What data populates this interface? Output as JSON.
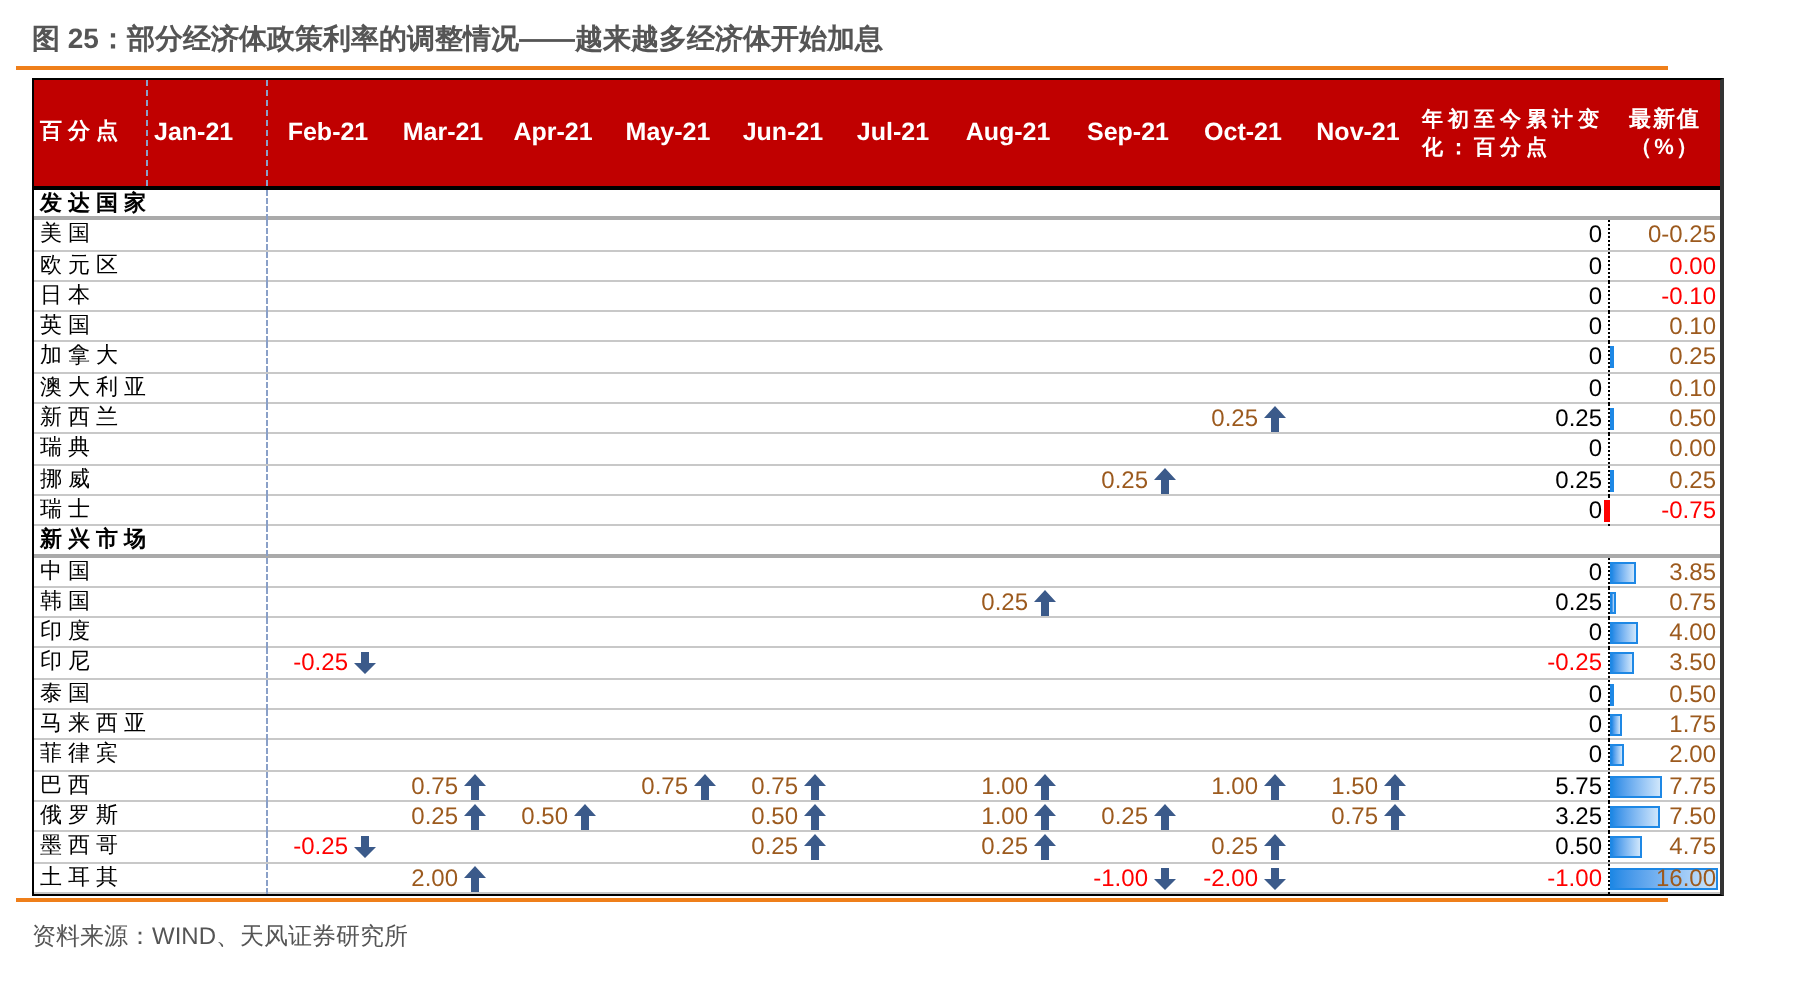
{
  "title": "图 25：部分经济体政策利率的调整情况——越来越多经济体开始加息",
  "header": {
    "corner": "百分点",
    "months": [
      "Jan-21",
      "Feb-21",
      "Mar-21",
      "Apr-21",
      "May-21",
      "Jun-21",
      "Jul-21",
      "Aug-21",
      "Sep-21",
      "Oct-21",
      "Nov-21"
    ],
    "ytd": "年初至今累计变化：百分点",
    "latest": "最新值（%）"
  },
  "sections": [
    {
      "name": "发达国家",
      "rows": [
        {
          "name": "美国",
          "changes": [
            {
              "kind": "none"
            },
            {
              "kind": "none"
            },
            {
              "kind": "none"
            },
            {
              "kind": "none"
            },
            {
              "kind": "none"
            },
            {
              "kind": "none"
            },
            {
              "kind": "none"
            },
            {
              "kind": "none"
            },
            {
              "kind": "none"
            },
            {
              "kind": "none"
            }
          ],
          "ytd": {
            "text": "0",
            "color": "#000000"
          },
          "latest": {
            "text": "0-0.25",
            "color": "#9c5a1e"
          }
        },
        {
          "name": "欧元区",
          "changes": [
            {
              "kind": "none"
            },
            {
              "kind": "none"
            },
            {
              "kind": "none"
            },
            {
              "kind": "none"
            },
            {
              "kind": "none"
            },
            {
              "kind": "none"
            },
            {
              "kind": "none"
            },
            {
              "kind": "none"
            },
            {
              "kind": "none"
            },
            {
              "kind": "none"
            }
          ],
          "ytd": {
            "text": "0",
            "color": "#000000"
          },
          "latest": {
            "text": "0.00",
            "color": "#ff0000"
          }
        },
        {
          "name": "日本",
          "changes": [
            {
              "kind": "none"
            },
            {
              "kind": "none"
            },
            {
              "kind": "none"
            },
            {
              "kind": "none"
            },
            {
              "kind": "none"
            },
            {
              "kind": "none"
            },
            {
              "kind": "none"
            },
            {
              "kind": "none"
            },
            {
              "kind": "none"
            },
            {
              "kind": "none"
            }
          ],
          "ytd": {
            "text": "0",
            "color": "#000000"
          },
          "latest": {
            "text": "-0.10",
            "color": "#ff0000"
          }
        },
        {
          "name": "英国",
          "changes": [
            {
              "kind": "none"
            },
            {
              "kind": "none"
            },
            {
              "kind": "none"
            },
            {
              "kind": "none"
            },
            {
              "kind": "none"
            },
            {
              "kind": "none"
            },
            {
              "kind": "none"
            },
            {
              "kind": "none"
            },
            {
              "kind": "none"
            },
            {
              "kind": "none"
            }
          ],
          "ytd": {
            "text": "0",
            "color": "#000000"
          },
          "latest": {
            "text": "0.10",
            "color": "#9c5a1e"
          }
        },
        {
          "name": "加拿大",
          "changes": [
            {
              "kind": "none"
            },
            {
              "kind": "none"
            },
            {
              "kind": "none"
            },
            {
              "kind": "none"
            },
            {
              "kind": "none"
            },
            {
              "kind": "none"
            },
            {
              "kind": "none"
            },
            {
              "kind": "none"
            },
            {
              "kind": "none"
            },
            {
              "kind": "none"
            }
          ],
          "ytd": {
            "text": "0",
            "color": "#000000"
          },
          "latest": {
            "text": "0.25",
            "color": "#9c5a1e"
          },
          "bar": {
            "kind": "positive",
            "level": 0.03
          }
        },
        {
          "name": "澳大利亚",
          "changes": [
            {
              "kind": "none"
            },
            {
              "kind": "none"
            },
            {
              "kind": "none"
            },
            {
              "kind": "none"
            },
            {
              "kind": "none"
            },
            {
              "kind": "none"
            },
            {
              "kind": "none"
            },
            {
              "kind": "none"
            },
            {
              "kind": "none"
            },
            {
              "kind": "none"
            }
          ],
          "ytd": {
            "text": "0",
            "color": "#000000"
          },
          "latest": {
            "text": "0.10",
            "color": "#9c5a1e"
          }
        },
        {
          "name": "新西兰",
          "changes": [
            {
              "kind": "none"
            },
            {
              "kind": "none"
            },
            {
              "kind": "none"
            },
            {
              "kind": "none"
            },
            {
              "kind": "none"
            },
            {
              "kind": "none"
            },
            {
              "kind": "none"
            },
            {
              "kind": "none"
            },
            {
              "text": "0.25",
              "kind": "up"
            },
            {
              "kind": "none"
            }
          ],
          "ytd": {
            "text": "0.25",
            "color": "#000000"
          },
          "latest": {
            "text": "0.50",
            "color": "#9c5a1e"
          },
          "bar": {
            "kind": "positive",
            "level": 0.04
          }
        },
        {
          "name": "瑞典",
          "changes": [
            {
              "kind": "none"
            },
            {
              "kind": "none"
            },
            {
              "kind": "none"
            },
            {
              "kind": "none"
            },
            {
              "kind": "none"
            },
            {
              "kind": "none"
            },
            {
              "kind": "none"
            },
            {
              "kind": "none"
            },
            {
              "kind": "none"
            },
            {
              "kind": "none"
            }
          ],
          "ytd": {
            "text": "0",
            "color": "#000000"
          },
          "latest": {
            "text": "0.00",
            "color": "#9c5a1e"
          }
        },
        {
          "name": "挪威",
          "changes": [
            {
              "kind": "none"
            },
            {
              "kind": "none"
            },
            {
              "kind": "none"
            },
            {
              "kind": "none"
            },
            {
              "kind": "none"
            },
            {
              "kind": "none"
            },
            {
              "kind": "none"
            },
            {
              "text": "0.25",
              "kind": "up"
            },
            {
              "kind": "none"
            },
            {
              "kind": "none"
            }
          ],
          "ytd": {
            "text": "0.25",
            "color": "#000000"
          },
          "latest": {
            "text": "0.25",
            "color": "#9c5a1e"
          },
          "bar": {
            "kind": "positive",
            "level": 0.03
          }
        },
        {
          "name": "瑞士",
          "changes": [
            {
              "kind": "none"
            },
            {
              "kind": "none"
            },
            {
              "kind": "none"
            },
            {
              "kind": "none"
            },
            {
              "kind": "none"
            },
            {
              "kind": "none"
            },
            {
              "kind": "none"
            },
            {
              "kind": "none"
            },
            {
              "kind": "none"
            },
            {
              "kind": "none"
            }
          ],
          "ytd": {
            "text": "0",
            "color": "#000000"
          },
          "latest": {
            "text": "-0.75",
            "color": "#ff0000"
          },
          "bar": {
            "kind": "negative",
            "level": 0.05
          }
        }
      ]
    },
    {
      "name": "新兴市场",
      "rows": [
        {
          "name": "中国",
          "changes": [
            {
              "kind": "none"
            },
            {
              "kind": "none"
            },
            {
              "kind": "none"
            },
            {
              "kind": "none"
            },
            {
              "kind": "none"
            },
            {
              "kind": "none"
            },
            {
              "kind": "none"
            },
            {
              "kind": "none"
            },
            {
              "kind": "none"
            },
            {
              "kind": "none"
            }
          ],
          "ytd": {
            "text": "0",
            "color": "#000000"
          },
          "latest": {
            "text": "3.85",
            "color": "#9c5a1e"
          },
          "bar": {
            "kind": "positive",
            "level": 0.24
          }
        },
        {
          "name": "韩国",
          "changes": [
            {
              "kind": "none"
            },
            {
              "kind": "none"
            },
            {
              "kind": "none"
            },
            {
              "kind": "none"
            },
            {
              "kind": "none"
            },
            {
              "kind": "none"
            },
            {
              "text": "0.25",
              "kind": "up"
            },
            {
              "kind": "none"
            },
            {
              "kind": "none"
            },
            {
              "kind": "none"
            }
          ],
          "ytd": {
            "text": "0.25",
            "color": "#000000"
          },
          "latest": {
            "text": "0.75",
            "color": "#9c5a1e"
          },
          "bar": {
            "kind": "positive",
            "level": 0.05
          }
        },
        {
          "name": "印度",
          "changes": [
            {
              "kind": "none"
            },
            {
              "kind": "none"
            },
            {
              "kind": "none"
            },
            {
              "kind": "none"
            },
            {
              "kind": "none"
            },
            {
              "kind": "none"
            },
            {
              "kind": "none"
            },
            {
              "kind": "none"
            },
            {
              "kind": "none"
            },
            {
              "kind": "none"
            }
          ],
          "ytd": {
            "text": "0",
            "color": "#000000"
          },
          "latest": {
            "text": "4.00",
            "color": "#9c5a1e"
          },
          "bar": {
            "kind": "positive",
            "level": 0.25
          }
        },
        {
          "name": "印尼",
          "changes": [
            {
              "text": "-0.25",
              "kind": "down"
            },
            {
              "kind": "none"
            },
            {
              "kind": "none"
            },
            {
              "kind": "none"
            },
            {
              "kind": "none"
            },
            {
              "kind": "none"
            },
            {
              "kind": "none"
            },
            {
              "kind": "none"
            },
            {
              "kind": "none"
            },
            {
              "kind": "none"
            }
          ],
          "ytd": {
            "text": "-0.25",
            "color": "#ff0000"
          },
          "latest": {
            "text": "3.50",
            "color": "#9c5a1e"
          },
          "bar": {
            "kind": "positive",
            "level": 0.22
          }
        },
        {
          "name": "泰国",
          "changes": [
            {
              "kind": "none"
            },
            {
              "kind": "none"
            },
            {
              "kind": "none"
            },
            {
              "kind": "none"
            },
            {
              "kind": "none"
            },
            {
              "kind": "none"
            },
            {
              "kind": "none"
            },
            {
              "kind": "none"
            },
            {
              "kind": "none"
            },
            {
              "kind": "none"
            }
          ],
          "ytd": {
            "text": "0",
            "color": "#000000"
          },
          "latest": {
            "text": "0.50",
            "color": "#9c5a1e"
          },
          "bar": {
            "kind": "positive",
            "level": 0.03
          }
        },
        {
          "name": "马来西亚",
          "changes": [
            {
              "kind": "none"
            },
            {
              "kind": "none"
            },
            {
              "kind": "none"
            },
            {
              "kind": "none"
            },
            {
              "kind": "none"
            },
            {
              "kind": "none"
            },
            {
              "kind": "none"
            },
            {
              "kind": "none"
            },
            {
              "kind": "none"
            },
            {
              "kind": "none"
            }
          ],
          "ytd": {
            "text": "0",
            "color": "#000000"
          },
          "latest": {
            "text": "1.75",
            "color": "#9c5a1e"
          },
          "bar": {
            "kind": "positive",
            "level": 0.11
          }
        },
        {
          "name": "菲律宾",
          "changes": [
            {
              "kind": "none"
            },
            {
              "kind": "none"
            },
            {
              "kind": "none"
            },
            {
              "kind": "none"
            },
            {
              "kind": "none"
            },
            {
              "kind": "none"
            },
            {
              "kind": "none"
            },
            {
              "kind": "none"
            },
            {
              "kind": "none"
            },
            {
              "kind": "none"
            }
          ],
          "ytd": {
            "text": "0",
            "color": "#000000"
          },
          "latest": {
            "text": "2.00",
            "color": "#9c5a1e"
          },
          "bar": {
            "kind": "positive",
            "level": 0.13
          }
        },
        {
          "name": "巴西",
          "changes": [
            {
              "kind": "none"
            },
            {
              "text": "0.75",
              "kind": "up"
            },
            {
              "kind": "none"
            },
            {
              "text": "0.75",
              "kind": "up"
            },
            {
              "text": "0.75",
              "kind": "up"
            },
            {
              "kind": "none"
            },
            {
              "text": "1.00",
              "kind": "up"
            },
            {
              "kind": "none"
            },
            {
              "text": "1.00",
              "kind": "up"
            },
            {
              "text": "1.50",
              "kind": "up"
            }
          ],
          "ytd": {
            "text": "5.75",
            "color": "#000000"
          },
          "latest": {
            "text": "7.75",
            "color": "#9c5a1e"
          },
          "bar": {
            "kind": "positive",
            "level": 0.48
          }
        },
        {
          "name": "俄罗斯",
          "changes": [
            {
              "kind": "none"
            },
            {
              "text": "0.25",
              "kind": "up"
            },
            {
              "text": "0.50",
              "kind": "up"
            },
            {
              "kind": "none"
            },
            {
              "text": "0.50",
              "kind": "up"
            },
            {
              "kind": "none"
            },
            {
              "text": "1.00",
              "kind": "up"
            },
            {
              "text": "0.25",
              "kind": "up"
            },
            {
              "kind": "none"
            },
            {
              "text": "0.75",
              "kind": "up"
            }
          ],
          "ytd": {
            "text": "3.25",
            "color": "#000000"
          },
          "latest": {
            "text": "7.50",
            "color": "#9c5a1e"
          },
          "bar": {
            "kind": "positive",
            "level": 0.47
          }
        },
        {
          "name": "墨西哥",
          "changes": [
            {
              "text": "-0.25",
              "kind": "down"
            },
            {
              "kind": "none"
            },
            {
              "kind": "none"
            },
            {
              "kind": "none"
            },
            {
              "text": "0.25",
              "kind": "up"
            },
            {
              "kind": "none"
            },
            {
              "text": "0.25",
              "kind": "up"
            },
            {
              "kind": "none"
            },
            {
              "text": "0.25",
              "kind": "up"
            },
            {
              "kind": "none"
            }
          ],
          "ytd": {
            "text": "0.50",
            "color": "#000000"
          },
          "latest": {
            "text": "4.75",
            "color": "#9c5a1e"
          },
          "bar": {
            "kind": "positive",
            "level": 0.3
          }
        },
        {
          "name": "土耳其",
          "changes": [
            {
              "kind": "none"
            },
            {
              "text": "2.00",
              "kind": "up"
            },
            {
              "kind": "none"
            },
            {
              "kind": "none"
            },
            {
              "kind": "none"
            },
            {
              "kind": "none"
            },
            {
              "kind": "none"
            },
            {
              "text": "-1.00",
              "kind": "down"
            },
            {
              "text": "-2.00",
              "kind": "down"
            },
            {
              "kind": "none"
            }
          ],
          "ytd": {
            "text": "-1.00",
            "color": "#ff0000"
          },
          "latest": {
            "text": "16.00",
            "color": "#9c5a1e"
          },
          "bar": {
            "kind": "positive",
            "level": 1
          }
        }
      ]
    }
  ],
  "source": "资料来源：WIND、天风证券研究所"
}
